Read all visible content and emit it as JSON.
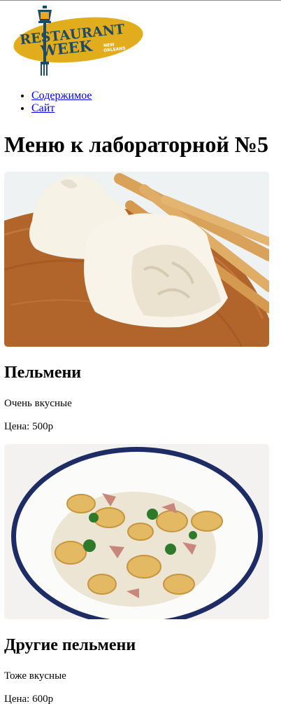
{
  "logo": {
    "line1": "RESTAURANT",
    "line2": "WEEK",
    "sub1": "NEW",
    "sub2": "ORLEANS"
  },
  "nav": {
    "items": [
      {
        "label": "Содержимое"
      },
      {
        "label": "Сайт"
      }
    ]
  },
  "page": {
    "title": "Меню к лабораторной №5"
  },
  "menu": {
    "items": [
      {
        "name": "Пельмени",
        "description": "Очень вкусные",
        "price": "Цена: 500р",
        "image": "burrata-with-breadsticks"
      },
      {
        "name": "Другие пельмени",
        "description": "Тоже вкусные",
        "price": "Цена: 600р",
        "image": "tortellini-bowl"
      }
    ]
  },
  "colors": {
    "link": "#0000ee",
    "logo_yellow": "#e2ad1c",
    "logo_navy": "#1f4a63"
  }
}
